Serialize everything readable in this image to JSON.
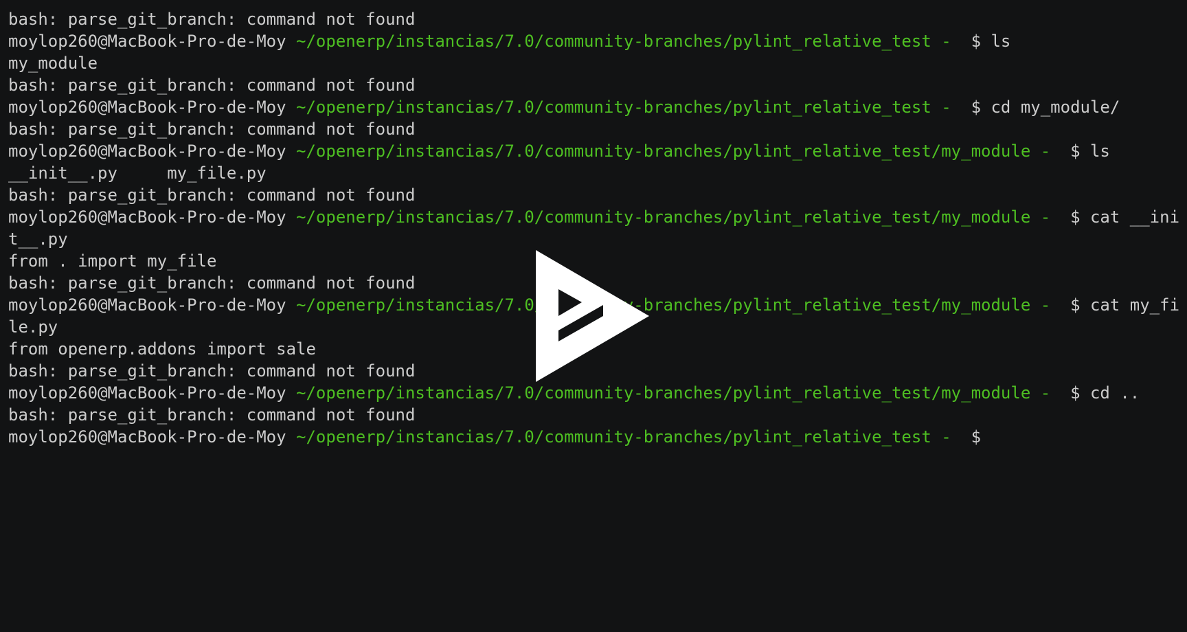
{
  "terminal": {
    "user_host": "moylop260@MacBook-Pro-de-Moy",
    "lines": [
      {
        "kind": "output",
        "text": "bash: parse_git_branch: command not found"
      },
      {
        "kind": "prompt",
        "path": " ~/openerp/instancias/7.0/community-branches/pylint_relative_test - ",
        "tail": " $ ls"
      },
      {
        "kind": "output",
        "text": "my_module"
      },
      {
        "kind": "output",
        "text": "bash: parse_git_branch: command not found"
      },
      {
        "kind": "prompt",
        "path": " ~/openerp/instancias/7.0/community-branches/pylint_relative_test - ",
        "tail": " $ cd my_module/"
      },
      {
        "kind": "output",
        "text": "bash: parse_git_branch: command not found"
      },
      {
        "kind": "prompt",
        "path": " ~/openerp/instancias/7.0/community-branches/pylint_relative_test/my_module - ",
        "tail": " $ ls"
      },
      {
        "kind": "output",
        "text": "__init__.py     my_file.py"
      },
      {
        "kind": "output",
        "text": "bash: parse_git_branch: command not found"
      },
      {
        "kind": "prompt",
        "path": " ~/openerp/instancias/7.0/community-branches/pylint_relative_test/my_module - ",
        "tail": " $ cat __ini"
      },
      {
        "kind": "output",
        "text": "t__.py"
      },
      {
        "kind": "output",
        "text": "from . import my_file"
      },
      {
        "kind": "output",
        "text": "bash: parse_git_branch: command not found"
      },
      {
        "kind": "prompt",
        "path": " ~/openerp/instancias/7.0/community-branches/pylint_relative_test/my_module - ",
        "tail": " $ cat my_fi"
      },
      {
        "kind": "output",
        "text": "le.py"
      },
      {
        "kind": "output",
        "text": "from openerp.addons import sale"
      },
      {
        "kind": "output",
        "text": "bash: parse_git_branch: command not found"
      },
      {
        "kind": "prompt",
        "path": " ~/openerp/instancias/7.0/community-branches/pylint_relative_test/my_module - ",
        "tail": " $ cd .."
      },
      {
        "kind": "output",
        "text": "bash: parse_git_branch: command not found"
      },
      {
        "kind": "prompt",
        "path": " ~/openerp/instancias/7.0/community-branches/pylint_relative_test - ",
        "tail": " $"
      }
    ]
  },
  "player": {
    "icon": "play-icon",
    "colors": {
      "background": "#121314",
      "text": "#cccccc",
      "path": "#4ebf22",
      "play": "#ffffff"
    }
  }
}
